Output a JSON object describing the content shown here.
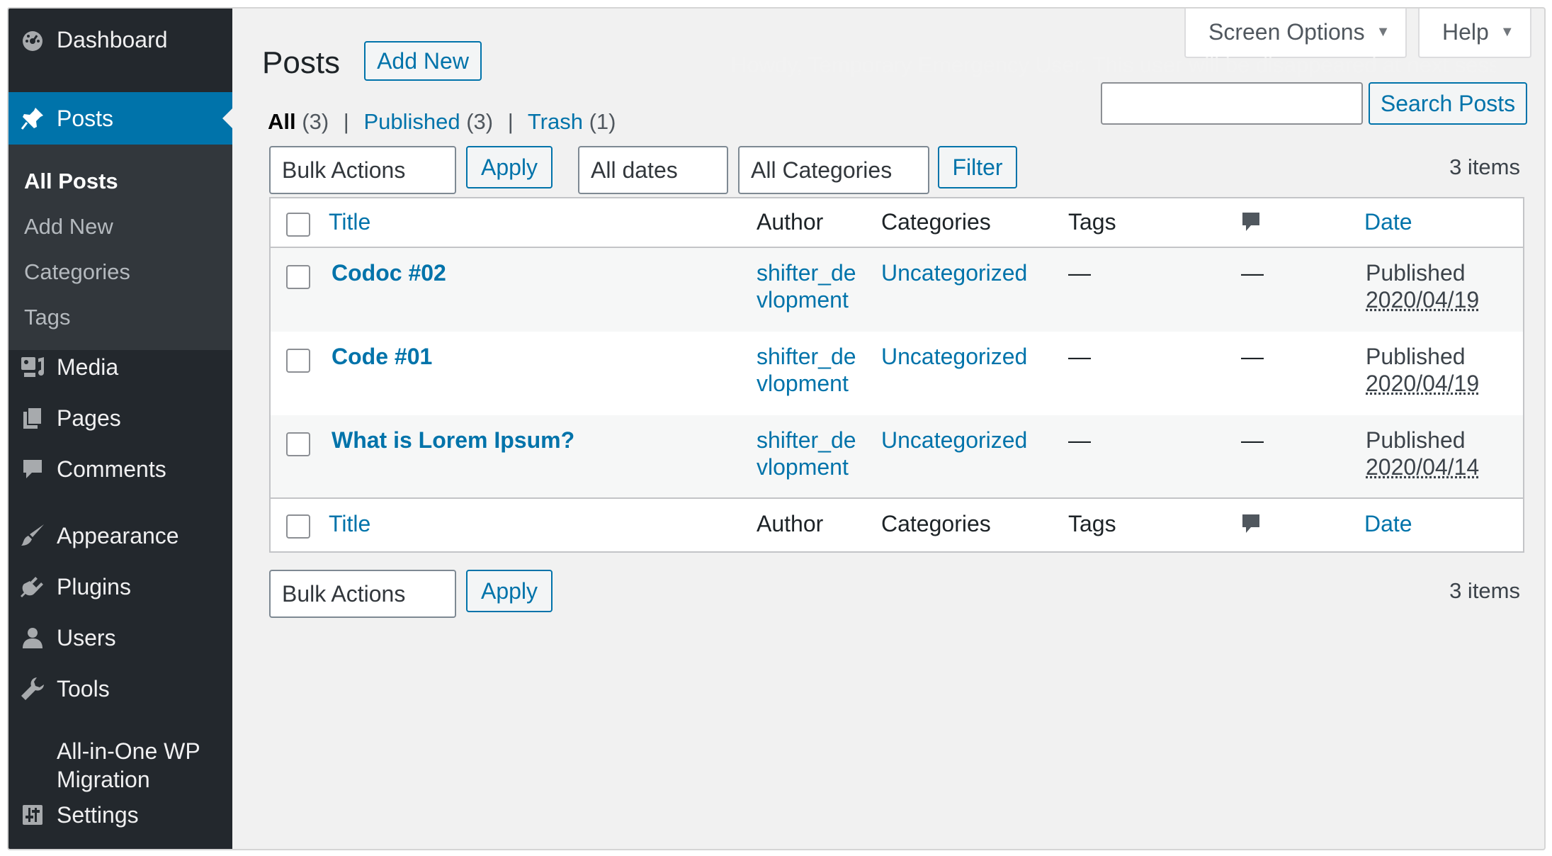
{
  "sidebar": {
    "dashboard": {
      "label": "Dashboard",
      "icon": "dashboard-icon"
    },
    "posts": {
      "label": "Posts",
      "icon": "pin-icon"
    },
    "submenu": [
      "All Posts",
      "Add New",
      "Categories",
      "Tags"
    ],
    "media": {
      "label": "Media",
      "icon": "media-icon"
    },
    "pages": {
      "label": "Pages",
      "icon": "pages-icon"
    },
    "comments": {
      "label": "Comments",
      "icon": "comment-icon"
    },
    "appearance": {
      "label": "Appearance",
      "icon": "brush-icon"
    },
    "plugins": {
      "label": "Plugins",
      "icon": "plugin-icon"
    },
    "users": {
      "label": "Users",
      "icon": "user-icon"
    },
    "tools": {
      "label": "Tools",
      "icon": "wrench-icon"
    },
    "aio_line1": "All-in-One WP",
    "aio_line2": "Migration",
    "settings": {
      "label": "Settings",
      "icon": "settings-icon"
    }
  },
  "header": {
    "title": "Posts",
    "add_new": "Add New",
    "screen_options": "Screen Options",
    "help": "Help",
    "notice": "Howdy, Temporary Emergency User. This user will be disappeared at next session."
  },
  "filters": {
    "all_label": "All",
    "all_count": "(3)",
    "published_label": "Published",
    "published_count": "(3)",
    "trash_label": "Trash",
    "trash_count": "(1)",
    "sep": "|"
  },
  "search": {
    "value": "",
    "button": "Search Posts"
  },
  "toolbar": {
    "bulk_actions": "Bulk Actions",
    "apply": "Apply",
    "dates": "All dates",
    "categories": "All Categories",
    "filter": "Filter",
    "items": "3 items"
  },
  "table": {
    "headers": {
      "title": "Title",
      "author": "Author",
      "categories": "Categories",
      "tags": "Tags",
      "date": "Date"
    },
    "rows": [
      {
        "title": "Codoc #02",
        "author_1": "shifter_de",
        "author_2": "vlopment",
        "category": "Uncategorized",
        "tags": "—",
        "comments": "—",
        "status": "Published",
        "date": "2020/04/19"
      },
      {
        "title": "Code #01",
        "author_1": "shifter_de",
        "author_2": "vlopment",
        "category": "Uncategorized",
        "tags": "—",
        "comments": "—",
        "status": "Published",
        "date": "2020/04/19"
      },
      {
        "title": "What is Lorem Ipsum?",
        "author_1": "shifter_de",
        "author_2": "vlopment",
        "category": "Uncategorized",
        "tags": "—",
        "comments": "—",
        "status": "Published",
        "date": "2020/04/14"
      }
    ]
  },
  "colors": {
    "sidebar": "#23282d",
    "accent": "#0073aa",
    "background": "#f1f1f1"
  }
}
